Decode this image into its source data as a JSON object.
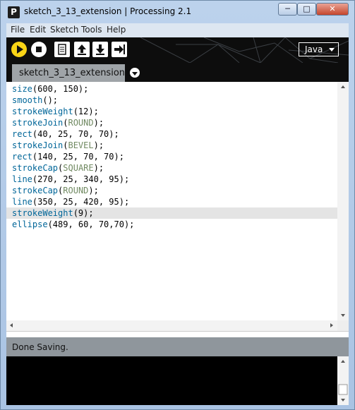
{
  "window": {
    "title": "sketch_3_13_extension | Processing 2.1",
    "app_icon_letter": "P"
  },
  "menu": [
    "File",
    "Edit",
    "Sketch",
    "Tools",
    "Help"
  ],
  "toolbar": {
    "buttons": [
      "run-icon",
      "stop-icon",
      "new-icon",
      "open-icon",
      "save-icon",
      "export-icon"
    ],
    "mode": "Java",
    "accent": "#f9d416"
  },
  "tab": {
    "label": "sketch_3_13_extension"
  },
  "editor": {
    "lines": [
      {
        "fn": "size",
        "args": "(600, 150);"
      },
      {
        "fn": "smooth",
        "args": "();"
      },
      {
        "fn": "strokeWeight",
        "args": "(12);"
      },
      {
        "fn": "strokeJoin",
        "const": "ROUND",
        "tail": ");"
      },
      {
        "fn": "rect",
        "args": "(40, 25, 70, 70);"
      },
      {
        "fn": "strokeJoin",
        "const": "BEVEL",
        "tail": ");"
      },
      {
        "fn": "rect",
        "args": "(140, 25, 70, 70);"
      },
      {
        "fn": "strokeCap",
        "const": "SQUARE",
        "tail": ");"
      },
      {
        "fn": "line",
        "args": "(270, 25, 340, 95);"
      },
      {
        "fn": "strokeCap",
        "const": "ROUND",
        "tail": ");"
      },
      {
        "fn": "line",
        "args": "(350, 25, 420, 95);"
      },
      {
        "fn": "strokeWeight",
        "args": "(9);",
        "highlighted": true
      },
      {
        "fn": "ellipse",
        "args": "(489, 60, 70,70);"
      }
    ],
    "colors": {
      "function": "#006699",
      "constant": "#718a62",
      "text": "#000000"
    }
  },
  "status": {
    "message": "Done Saving."
  }
}
